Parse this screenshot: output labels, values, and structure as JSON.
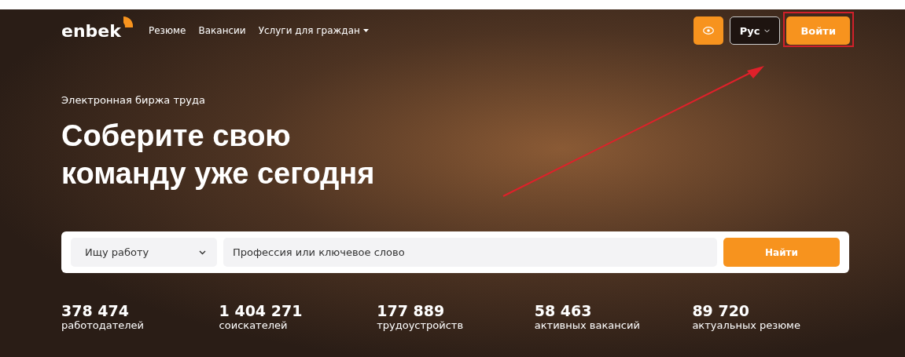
{
  "header": {
    "logo": "enbek",
    "nav": [
      {
        "label": "Резюме",
        "dropdown": false
      },
      {
        "label": "Вакансии",
        "dropdown": false
      },
      {
        "label": "Услуги для граждан",
        "dropdown": true
      }
    ],
    "language": "Рус",
    "login": "Войти"
  },
  "hero": {
    "subtitle": "Электронная биржа труда",
    "title_lines": [
      "Соберите свою",
      "команду уже сегодня"
    ]
  },
  "search": {
    "category": "Ищу работу",
    "placeholder": "Профессия или ключевое слово",
    "button": "Найти"
  },
  "stats": [
    {
      "value": "378 474",
      "label": "работодателей"
    },
    {
      "value": "1 404 271",
      "label": "соискателей"
    },
    {
      "value": "177 889",
      "label": "трудоустройств"
    },
    {
      "value": "58 463",
      "label": "активных вакансий"
    },
    {
      "value": "89 720",
      "label": "актуальных резюме"
    }
  ]
}
